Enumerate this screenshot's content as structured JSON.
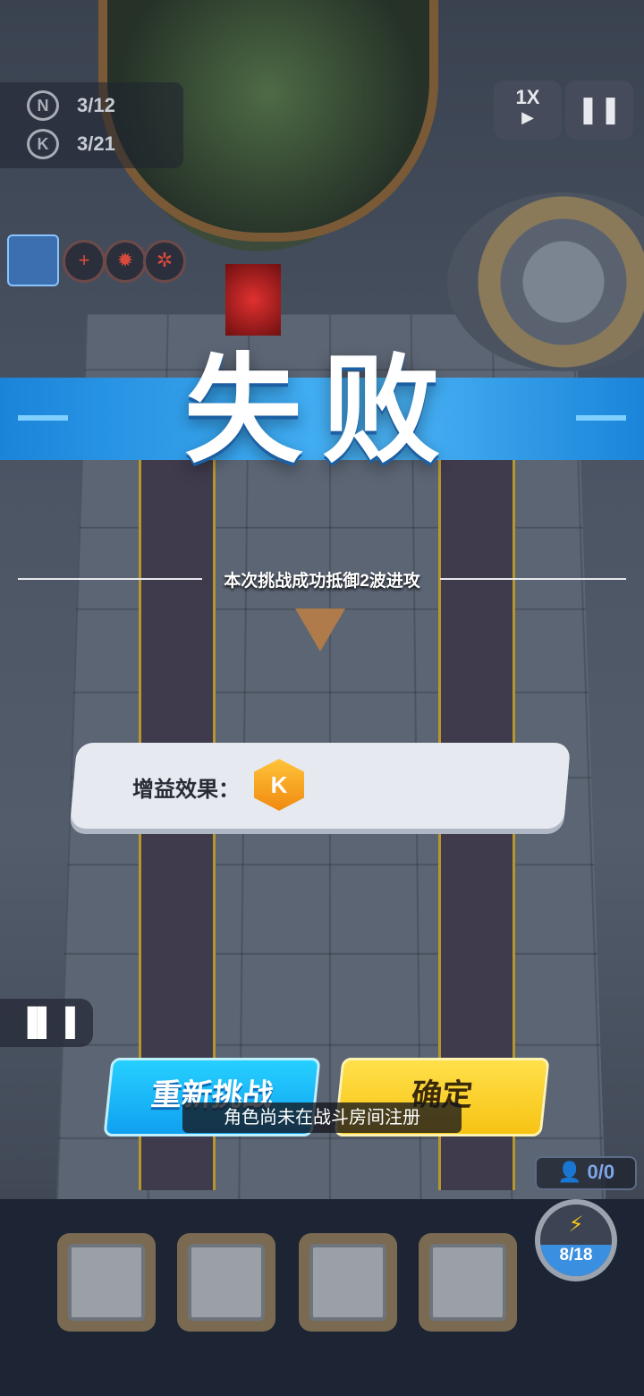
{
  "hud": {
    "counters": [
      {
        "icon": "n-emblem-icon",
        "glyph": "N",
        "value": "3/12"
      },
      {
        "icon": "k-emblem-icon",
        "glyph": "K",
        "value": "3/21"
      }
    ],
    "speed_label": "1X",
    "speed_arrow": "▶",
    "pause_glyph": "❚❚",
    "status_icons": [
      "plus-icon",
      "gear-icon",
      "octopus-icon"
    ]
  },
  "result": {
    "title": "失败",
    "waves_text": "本次挑战成功抵御2波进攻",
    "buff_label": "增益效果：",
    "buff_glyph": "K"
  },
  "buttons": {
    "retry": "重新挑战",
    "confirm": "确定"
  },
  "toast": "角色尚未在战斗房间注册",
  "stats_glyph": "▐▌▐",
  "population": "0/0",
  "energy": {
    "value": "8/18",
    "fill_fraction": 0.44,
    "bolt": "⚡"
  },
  "colors": {
    "banner": "#3aa7ef",
    "retry": "#10a0f0",
    "confirm": "#f7c314",
    "buff": "#f08a10"
  }
}
